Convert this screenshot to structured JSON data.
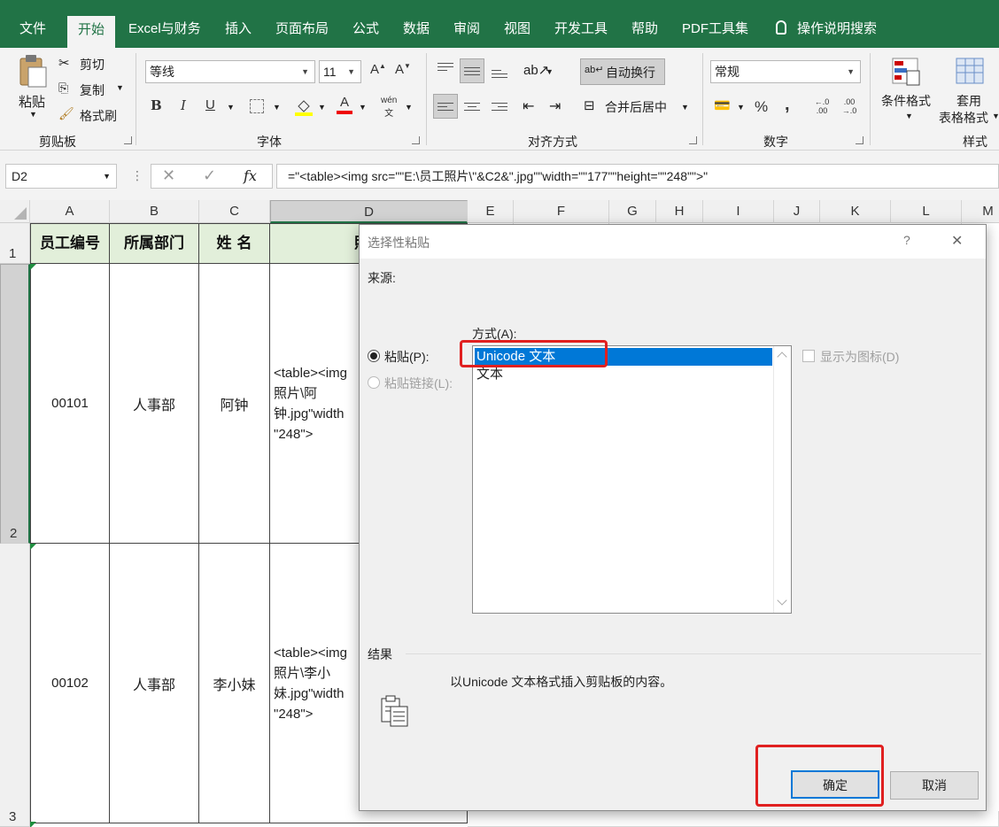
{
  "tabs": [
    "文件",
    "开始",
    "Excel与财务",
    "插入",
    "页面布局",
    "公式",
    "数据",
    "审阅",
    "视图",
    "开发工具",
    "帮助",
    "PDF工具集",
    "操作说明搜索"
  ],
  "ribbon": {
    "clipboard": {
      "paste": "粘贴",
      "cut": "剪切",
      "copy": "复制",
      "format_painter": "格式刷",
      "label": "剪贴板"
    },
    "font": {
      "name": "等线",
      "size": "11",
      "grow": "A",
      "shrink": "A",
      "bold": "B",
      "italic": "I",
      "underline": "U",
      "font_color": "A",
      "phonetic": "wén",
      "label": "字体"
    },
    "alignment": {
      "wrap": "自动换行",
      "merge": "合并后居中",
      "label": "对齐方式"
    },
    "number": {
      "format": "常规",
      "percent": "%",
      "comma": ",",
      "inc_decimal": "←.0 .00",
      "dec_decimal": ".00 →.0",
      "label": "数字"
    },
    "styles": {
      "conditional": "条件格式",
      "table_line1": "套用",
      "table_line2": "表格格式",
      "label": "样式"
    }
  },
  "formula_bar": {
    "name_box": "D2",
    "fx": "fx",
    "formula": "=\"<table><img src=\"\"E:\\员工照片\\\"&C2&\".jpg\"\"width=\"\"177\"\"height=\"\"248\"\">\""
  },
  "columns": [
    "A",
    "B",
    "C",
    "D",
    "E",
    "F",
    "G",
    "H",
    "I",
    "J",
    "K",
    "L",
    "M"
  ],
  "rows": [
    "1",
    "2",
    "3"
  ],
  "sheet": {
    "headers": [
      "员工编号",
      "所属部门",
      "姓 名",
      "照"
    ],
    "data": [
      {
        "id": "00101",
        "dept": "人事部",
        "name": "阿钟",
        "formula_lines": [
          "<table><img",
          "照片\\阿",
          "钟.jpg\"width",
          "\"248\">"
        ]
      },
      {
        "id": "00102",
        "dept": "人事部",
        "name": "李小妹",
        "formula_lines": [
          "<table><img",
          "照片\\李小",
          "妹.jpg\"width",
          "\"248\">"
        ]
      }
    ]
  },
  "dialog": {
    "title": "选择性粘贴",
    "help": "?",
    "close": "✕",
    "source_label": "来源:",
    "as_label": "方式(A):",
    "paste_option": "粘贴(P):",
    "paste_link_option": "粘贴链接(L):",
    "list_items": [
      "Unicode 文本",
      "文本"
    ],
    "display_as_icon": "显示为图标(D)",
    "result_label": "结果",
    "result_text": "以Unicode 文本格式插入剪贴板的内容。",
    "ok": "确定",
    "cancel": "取消"
  },
  "colors": {
    "excel_green": "#217346",
    "header_fill": "#e2efda",
    "highlight_red": "#e02020",
    "selection_blue": "#0078d7"
  }
}
